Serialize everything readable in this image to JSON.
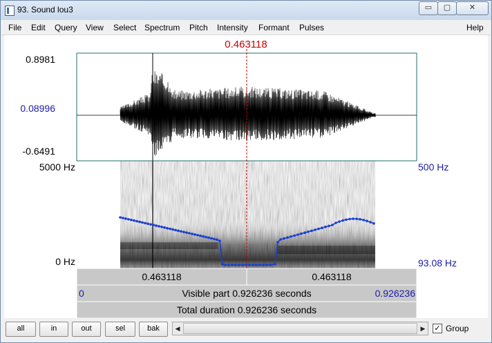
{
  "window": {
    "title": "93. Sound lou3",
    "minimize_glyph": "▭",
    "maximize_glyph": "▢",
    "close_glyph": "✕"
  },
  "menu": [
    "File",
    "Edit",
    "Query",
    "View",
    "Select",
    "Spectrum",
    "Pitch",
    "Intensity",
    "Formant",
    "Pulses"
  ],
  "help": "Help",
  "cursor_time": "0.463118",
  "waveform": {
    "max": "0.8981",
    "cursor_value": "0.08996",
    "min": "-0.6491"
  },
  "spectrogram": {
    "freq_top": "5000 Hz",
    "freq_bottom": "0 Hz",
    "pitch_top": "500 Hz",
    "pitch_bottom": "93.08 Hz"
  },
  "time_bar": {
    "left_segment": "0.463118",
    "right_segment": "0.463118",
    "visible_start": "0",
    "visible_part": "Visible part 0.926236 seconds",
    "visible_end": "0.926236",
    "total_duration": "Total duration 0.926236 seconds"
  },
  "buttons": {
    "all": "all",
    "in": "in",
    "out": "out",
    "sel": "sel",
    "bak": "bak"
  },
  "scroll": {
    "left_arrow": "◀",
    "right_arrow": "▶"
  },
  "group": {
    "label": "Group",
    "checked": true,
    "check_glyph": "✓"
  },
  "colors": {
    "cursor": "#cc0000",
    "pitch": "#1a3fd0",
    "axis_blue": "#1a1aa8",
    "bar_fill": "#c8c8c8"
  }
}
